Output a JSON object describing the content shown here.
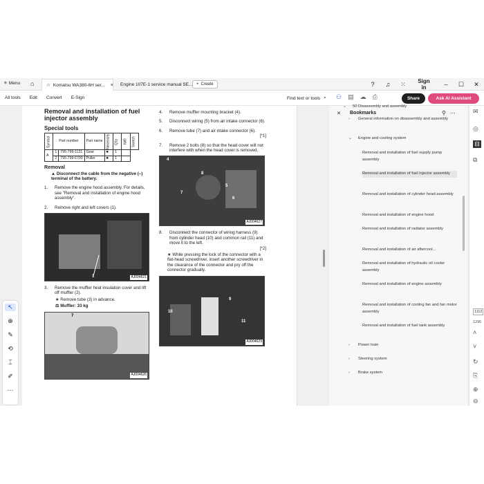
{
  "tabs": {
    "menu": "Menu",
    "tab1": "Komatsu WA380-6H ser...",
    "tab2": "Engine 107E-1 service manual SE...",
    "new_tab": "Create"
  },
  "window": {
    "sign_in": "Sign in"
  },
  "toolbar": {
    "all_tools": "All tools",
    "edit": "Edit",
    "convert": "Convert",
    "esign": "E-Sign",
    "find": "Find text or tools",
    "share": "Share",
    "ai": "Ask AI Assistant"
  },
  "doc": {
    "title": "Removal and installation of fuel injector assembly",
    "special_tools": "Special tools",
    "table": {
      "headers": [
        "Symbol",
        "Part number",
        "Part name",
        "Necessity",
        "Q'ty",
        "N/R",
        "Sketch"
      ],
      "rows": [
        [
          "A",
          "1",
          "795-799-1131",
          "Gear",
          "■",
          "1",
          ""
        ],
        [
          "",
          "2",
          "795-799-6700",
          "Puller",
          "■",
          "1",
          ""
        ]
      ]
    },
    "removal": "Removal",
    "warning": "Disconnect the cable from the negative (–) terminal of the battery.",
    "steps_left": [
      {
        "n": "1.",
        "t": "Remove the engine hood assembly. For details, see \"Removal and installation of engine hood assembly\"."
      },
      {
        "n": "2.",
        "t": "Remove right and left covers (1)."
      },
      {
        "n": "3.",
        "t": "Remove the muffler heat insulation cover and lift off muffler (2)."
      }
    ],
    "step3_sub": "Remove tube (3) in advance.",
    "muffler": "Muffler: 33 kg",
    "steps_right": [
      {
        "n": "4.",
        "t": "Remove muffler mounting bracket (4)."
      },
      {
        "n": "5.",
        "t": "Disconnect wiring (5) from air intake connector (6)."
      },
      {
        "n": "6.",
        "t": "Remove tube (7) and air intake connector (6)."
      },
      {
        "n": "7.",
        "t": "Remove 2 bolts (8) so that the head cover will not interfere with when the head cover is removed."
      },
      {
        "n": "8.",
        "t": "Disconnect the connector of wiring harness (9) from cylinder head (10) and common rail (11) and move it to the left."
      }
    ],
    "ref6": "[*1]",
    "ref8": "[*2]",
    "step8_note": "While pressing the lock of the connector with a flat-head screwdriver, insert another screwdriver in the clearance of the connector and pry off the connector gradually.",
    "photo_codes": [
      "AJ004621",
      "AJ004626",
      "AJ004627",
      "AJ004629"
    ],
    "photo_labels": {
      "p1": "1",
      "p2": "7",
      "p3a": "4",
      "p3b": "6",
      "p3c": "5",
      "p3d": "7",
      "p3e": "8",
      "p4a": "10",
      "p4b": "11",
      "p4c": "9"
    }
  },
  "bookmarks": {
    "title": "Bookmarks",
    "items": [
      {
        "chev": "⌄",
        "label": "50 Disassembly and assembly"
      },
      {
        "chev": "›",
        "label": "General information on disassembly and assembly"
      },
      {
        "chev": "⌄",
        "label": "Engine and cooling system"
      },
      {
        "chev": "",
        "label": "Removal and installation of fuel supply pump assembly"
      },
      {
        "chev": "",
        "label": "Removal and installation of fuel injector assembly"
      },
      {
        "chev": "",
        "label": "Removal and installation of cylinder head assembly"
      },
      {
        "chev": "",
        "label": "Removal and installation of engine hood"
      },
      {
        "chev": "",
        "label": "Removal and installation of radiator assembly"
      },
      {
        "chev": "",
        "label": "Removal and installation of air aftercool..."
      },
      {
        "chev": "",
        "label": "Removal and installation of hydraulic oil cooler assembly"
      },
      {
        "chev": "",
        "label": "Removal and installation of engine assembly"
      },
      {
        "chev": "",
        "label": "Removal and installation of cooling fan and fan motor assembly"
      },
      {
        "chev": "",
        "label": "Removal and installation of fuel tank assembly"
      },
      {
        "chev": "›",
        "label": "Power train"
      },
      {
        "chev": "›",
        "label": "Steering system"
      },
      {
        "chev": "›",
        "label": "Brake system"
      }
    ]
  },
  "page_nav": {
    "current": "1112",
    "total": "1296"
  }
}
